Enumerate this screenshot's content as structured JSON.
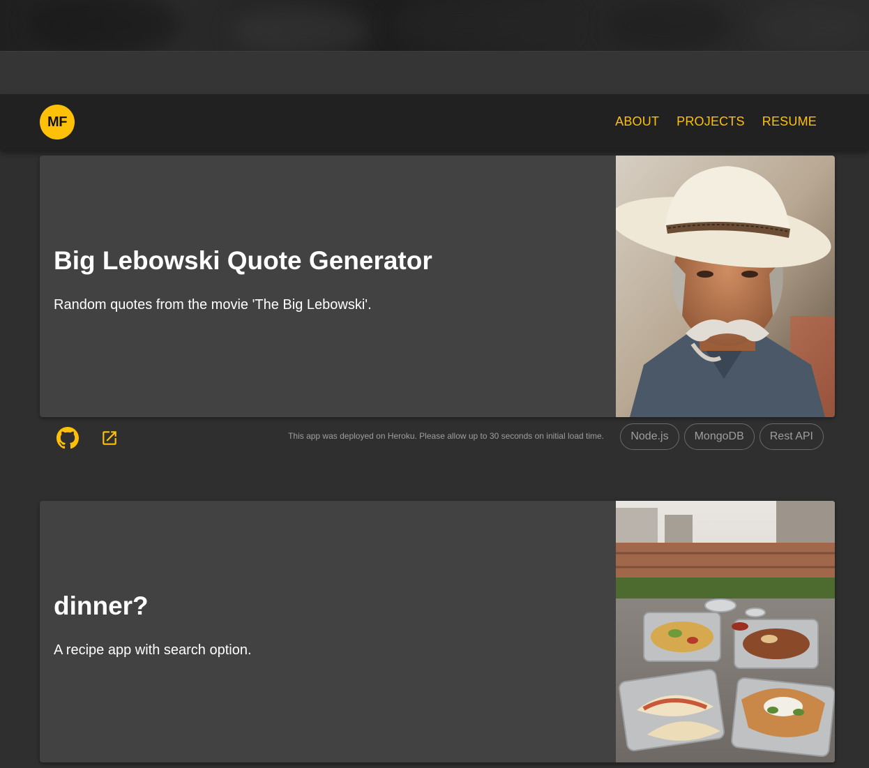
{
  "header": {
    "logo_text": "MF",
    "nav": [
      {
        "label": "ABOUT"
      },
      {
        "label": "PROJECTS"
      },
      {
        "label": "RESUME"
      }
    ],
    "accent_color": "#ffc107"
  },
  "projects": [
    {
      "title": "Big Lebowski Quote Generator",
      "description": "Random quotes from the movie 'The Big Lebowski'.",
      "image": "cowboy-portrait-image",
      "note": "This app was deployed on Heroku. Please allow up to 30 seconds on initial load time.",
      "tags": [
        "Node.js",
        "MongoDB",
        "Rest API"
      ],
      "icons": [
        "github-icon",
        "external-link-icon"
      ]
    },
    {
      "title": "dinner?",
      "description": "A recipe app with search option.",
      "image": "food-table-image"
    }
  ]
}
